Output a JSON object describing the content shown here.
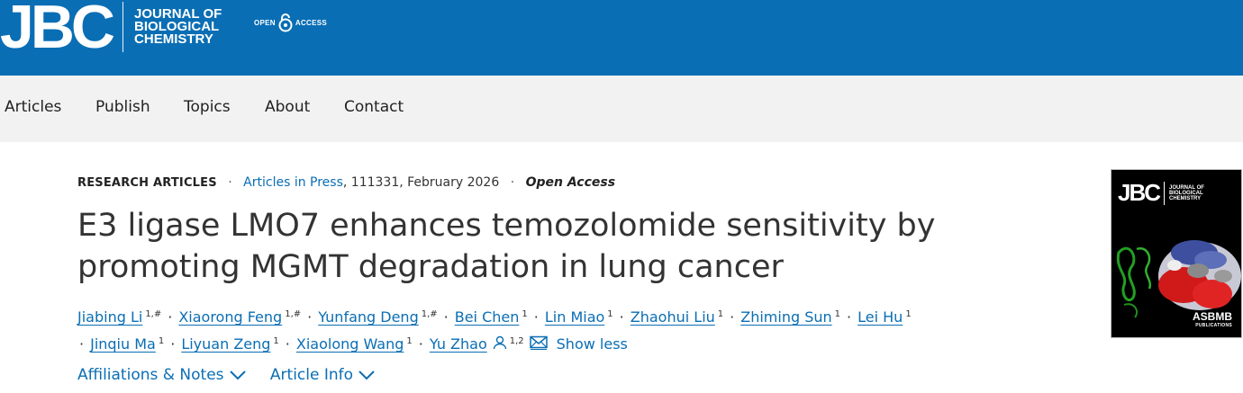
{
  "header": {
    "logo_mark": "JBC",
    "logo_lines": [
      "JOURNAL OF",
      "BIOLOGICAL",
      "CHEMISTRY"
    ],
    "open_access_left": "OPEN",
    "open_access_right": "ACCESS",
    "background_color": "#0a6eb4"
  },
  "nav": {
    "items": [
      "Articles",
      "Publish",
      "Topics",
      "About",
      "Contact"
    ]
  },
  "article": {
    "category": "RESEARCH ARTICLES",
    "separator": "·",
    "in_press": "Articles in Press",
    "id_date": ", 111331, February 2026",
    "access": "Open Access",
    "title": "E3 ligase LMO7 enhances temozolomide sensitivity by promoting MGMT degradation in lung cancer",
    "authors": [
      {
        "name": "Jiabing Li",
        "sup": "1,#"
      },
      {
        "name": "Xiaorong Feng",
        "sup": "1,#"
      },
      {
        "name": "Yunfang Deng",
        "sup": "1,#"
      },
      {
        "name": "Bei Chen",
        "sup": "1"
      },
      {
        "name": "Lin Miao",
        "sup": "1"
      },
      {
        "name": "Zhaohui Liu",
        "sup": "1"
      },
      {
        "name": "Zhiming Sun",
        "sup": "1"
      },
      {
        "name": "Lei Hu",
        "sup": "1"
      },
      {
        "name": "Jinqiu Ma",
        "sup": "1"
      },
      {
        "name": "Liyuan Zeng",
        "sup": "1"
      },
      {
        "name": "Xiaolong Wang",
        "sup": "1"
      },
      {
        "name": "Yu Zhao",
        "sup": "1,2"
      }
    ],
    "show_less": "Show less",
    "affiliations_toggle": "Affiliations & Notes",
    "article_info_toggle": "Article Info",
    "link_color": "#0a6eb4"
  },
  "cover": {
    "logo_mark": "JBC",
    "logo_lines": [
      "JOURNAL OF",
      "BIOLOGICAL",
      "CHEMISTRY"
    ],
    "publisher": "ASBMB",
    "publisher_sub": "PUBLICATIONS"
  }
}
